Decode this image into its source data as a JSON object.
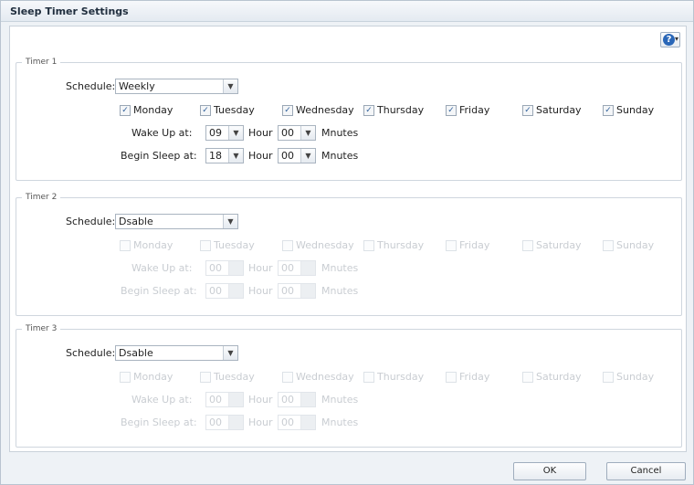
{
  "dialog": {
    "title": "Sleep Timer Settings",
    "help_icon": "question-mark-icon"
  },
  "labels": {
    "schedule": "Schedule:",
    "wake_up": "Wake Up at:",
    "begin_sleep": "Begin Sleep at:",
    "hour": "Hour",
    "minutes": "Mnutes"
  },
  "days": [
    "Monday",
    "Tuesday",
    "Wednesday",
    "Thursday",
    "Friday",
    "Saturday",
    "Sunday"
  ],
  "timers": [
    {
      "legend": "Timer 1",
      "schedule": "Weekly",
      "enabled": true,
      "days_checked": [
        true,
        true,
        true,
        true,
        true,
        true,
        true
      ],
      "wake_hour": "09",
      "wake_minute": "00",
      "sleep_hour": "18",
      "sleep_minute": "00"
    },
    {
      "legend": "Timer 2",
      "schedule": "Dsable",
      "enabled": false,
      "days_checked": [
        false,
        false,
        false,
        false,
        false,
        false,
        false
      ],
      "wake_hour": "00",
      "wake_minute": "00",
      "sleep_hour": "00",
      "sleep_minute": "00"
    },
    {
      "legend": "Timer 3",
      "schedule": "Dsable",
      "enabled": false,
      "days_checked": [
        false,
        false,
        false,
        false,
        false,
        false,
        false
      ],
      "wake_hour": "00",
      "wake_minute": "00",
      "sleep_hour": "00",
      "sleep_minute": "00"
    }
  ],
  "buttons": {
    "ok": "OK",
    "cancel": "Cancel"
  },
  "colors": {
    "accent": "#2a67b8",
    "border": "#c9d1da",
    "disabled_text": "#c9cdd2"
  }
}
